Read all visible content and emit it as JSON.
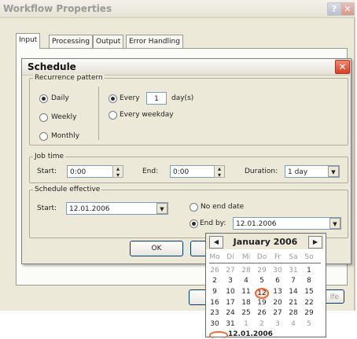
{
  "window": {
    "title": "Workflow Properties"
  },
  "tabs": [
    "Input",
    "Processing",
    "Output",
    "Error Handling"
  ],
  "schedule": {
    "title": "Schedule",
    "recurrence": {
      "legend": "Recurrence pattern",
      "options": [
        "Daily",
        "Weekly",
        "Monthly"
      ],
      "selected": "Daily",
      "every_label": "Every",
      "every_value": "1",
      "every_unit": "day(s)",
      "every_weekday": "Every weekday"
    },
    "job_time": {
      "legend": "Job time",
      "start_label": "Start:",
      "start_value": "0:00",
      "end_label": "End:",
      "end_value": "0:00",
      "duration_label": "Duration:",
      "duration_value": "1 day"
    },
    "effective": {
      "legend": "Schedule effective",
      "start_label": "Start:",
      "start_value": "12.01.2006",
      "no_end_label": "No end date",
      "end_by_label": "End by:",
      "end_by_value": "12.01.2006"
    },
    "ok_label": "OK"
  },
  "calendar": {
    "month": "January 2006",
    "weekdays": [
      "Mo",
      "Di",
      "Mi",
      "Do",
      "Fr",
      "Sa",
      "So"
    ],
    "weeks": [
      [
        "26",
        "27",
        "28",
        "29",
        "30",
        "31",
        "1"
      ],
      [
        "2",
        "3",
        "4",
        "5",
        "6",
        "7",
        "8"
      ],
      [
        "9",
        "10",
        "11",
        "12",
        "13",
        "14",
        "15"
      ],
      [
        "16",
        "17",
        "18",
        "19",
        "20",
        "21",
        "22"
      ],
      [
        "23",
        "24",
        "25",
        "26",
        "27",
        "28",
        "29"
      ],
      [
        "30",
        "31",
        "1",
        "2",
        "3",
        "4",
        "5"
      ]
    ],
    "muted": [
      [
        0,
        0
      ],
      [
        0,
        1
      ],
      [
        0,
        2
      ],
      [
        0,
        3
      ],
      [
        0,
        4
      ],
      [
        0,
        5
      ],
      [
        5,
        2
      ],
      [
        5,
        3
      ],
      [
        5,
        4
      ],
      [
        5,
        5
      ],
      [
        5,
        6
      ]
    ],
    "selected": [
      2,
      3
    ],
    "today_label": "12.01.2006"
  },
  "background_button_fragment": "lfe"
}
